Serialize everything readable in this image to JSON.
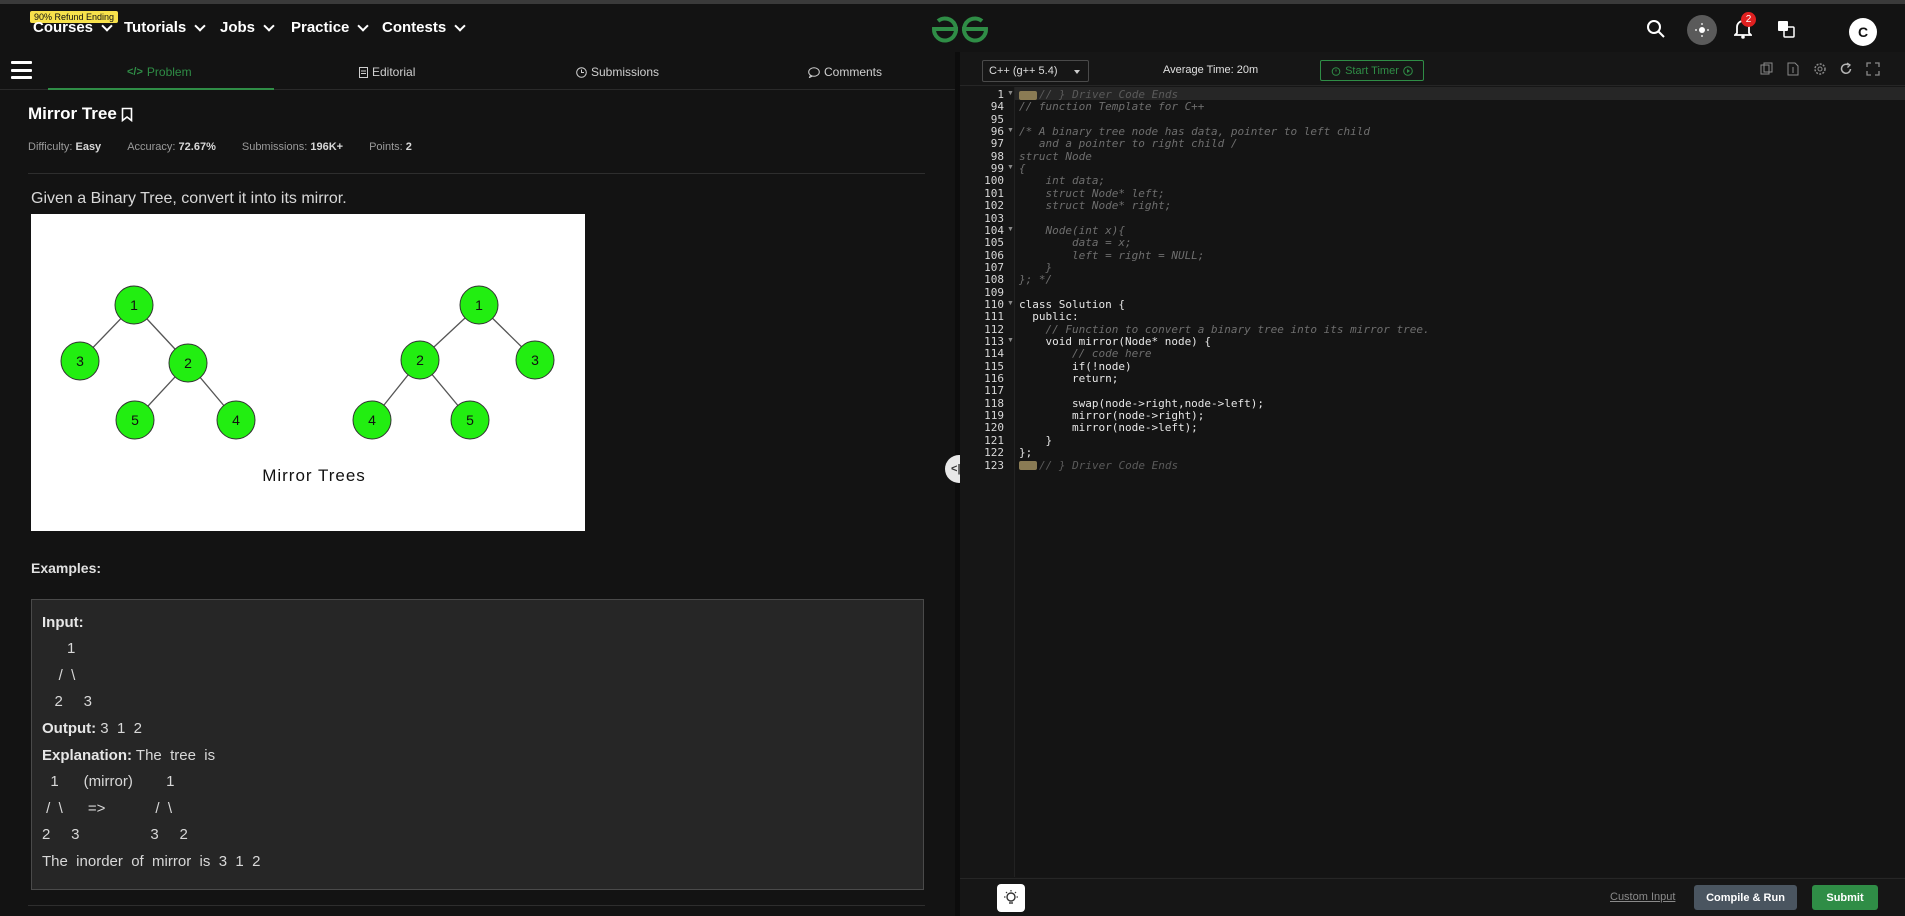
{
  "nav": {
    "refund_badge": "90% Refund Ending",
    "items": [
      "Courses",
      "Tutorials",
      "Jobs",
      "Practice",
      "Contests"
    ],
    "notification_count": "2",
    "avatar_letter": "C",
    "brand_color": "#2f8d46"
  },
  "tabs": {
    "problem": "Problem",
    "editorial": "Editorial",
    "submissions": "Submissions",
    "comments": "Comments"
  },
  "problem": {
    "title": "Mirror Tree",
    "difficulty_label": "Difficulty:",
    "difficulty": "Easy",
    "accuracy_label": "Accuracy:",
    "accuracy": "72.67%",
    "submissions_label": "Submissions:",
    "submissions": "196K+",
    "points_label": "Points:",
    "points": "2",
    "description": "Given a Binary Tree, convert it into its mirror.",
    "image_caption": "Mirror Trees",
    "tree_left": [
      "1",
      "3",
      "2",
      "5",
      "4"
    ],
    "tree_right": [
      "1",
      "2",
      "3",
      "4",
      "5"
    ],
    "examples_label": "Examples:"
  },
  "example": {
    "input_label": "Input:",
    "input_lines": [
      "      1",
      "    /  \\",
      "   2     3"
    ],
    "output_label": "Output:",
    "output_value": " 3  1  2",
    "explanation_label": "Explanation:",
    "explanation_value": " The  tree  is",
    "explanation_lines": [
      "  1      (mirror)        1",
      " /  \\      =>            /  \\",
      "2     3                 3     2"
    ],
    "final_line": "The  inorder  of  mirror  is  3  1  2"
  },
  "editor": {
    "language": "C++ (g++ 5.4)",
    "avg_time": "Average Time: 20m",
    "start_timer": "Start Timer",
    "custom_input": "Custom Input",
    "compile_run": "Compile & Run",
    "submit": "Submit",
    "lines": [
      {
        "n": "1",
        "text": "// } Driver Code Ends",
        "cls": "faded",
        "marker": true,
        "fold": true
      },
      {
        "n": "94",
        "text": "// function Template for C++",
        "cls": "comment"
      },
      {
        "n": "95",
        "text": "",
        "cls": ""
      },
      {
        "n": "96",
        "text": "/* A binary tree node has data, pointer to left child",
        "cls": "comment",
        "fold": true
      },
      {
        "n": "97",
        "text": "   and a pointer to right child /",
        "cls": "comment"
      },
      {
        "n": "98",
        "text": "struct Node",
        "cls": "comment"
      },
      {
        "n": "99",
        "text": "{",
        "cls": "comment",
        "fold": true
      },
      {
        "n": "100",
        "text": "    int data;",
        "cls": "comment"
      },
      {
        "n": "101",
        "text": "    struct Node* left;",
        "cls": "comment"
      },
      {
        "n": "102",
        "text": "    struct Node* right;",
        "cls": "comment"
      },
      {
        "n": "103",
        "text": "",
        "cls": ""
      },
      {
        "n": "104",
        "text": "    Node(int x){",
        "cls": "comment",
        "fold": true
      },
      {
        "n": "105",
        "text": "        data = x;",
        "cls": "comment"
      },
      {
        "n": "106",
        "text": "        left = right = NULL;",
        "cls": "comment"
      },
      {
        "n": "107",
        "text": "    }",
        "cls": "comment"
      },
      {
        "n": "108",
        "text": "}; */",
        "cls": "comment"
      },
      {
        "n": "109",
        "text": "",
        "cls": ""
      },
      {
        "n": "110",
        "text": "class Solution {",
        "cls": "",
        "fold": true
      },
      {
        "n": "111",
        "text": "  public:",
        "cls": ""
      },
      {
        "n": "112",
        "text": "    // Function to convert a binary tree into its mirror tree.",
        "cls": "comment"
      },
      {
        "n": "113",
        "text": "    void mirror(Node* node) {",
        "cls": "",
        "fold": true
      },
      {
        "n": "114",
        "text": "        // code here",
        "cls": "comment"
      },
      {
        "n": "115",
        "text": "        if(!node)",
        "cls": ""
      },
      {
        "n": "116",
        "text": "        return;",
        "cls": ""
      },
      {
        "n": "117",
        "text": "",
        "cls": ""
      },
      {
        "n": "118",
        "text": "        swap(node->right,node->left);",
        "cls": ""
      },
      {
        "n": "119",
        "text": "        mirror(node->right);",
        "cls": ""
      },
      {
        "n": "120",
        "text": "        mirror(node->left);",
        "cls": ""
      },
      {
        "n": "121",
        "text": "    }",
        "cls": ""
      },
      {
        "n": "122",
        "text": "};",
        "cls": ""
      },
      {
        "n": "123",
        "text": "// } Driver Code Ends",
        "cls": "faded",
        "marker": true
      }
    ]
  }
}
